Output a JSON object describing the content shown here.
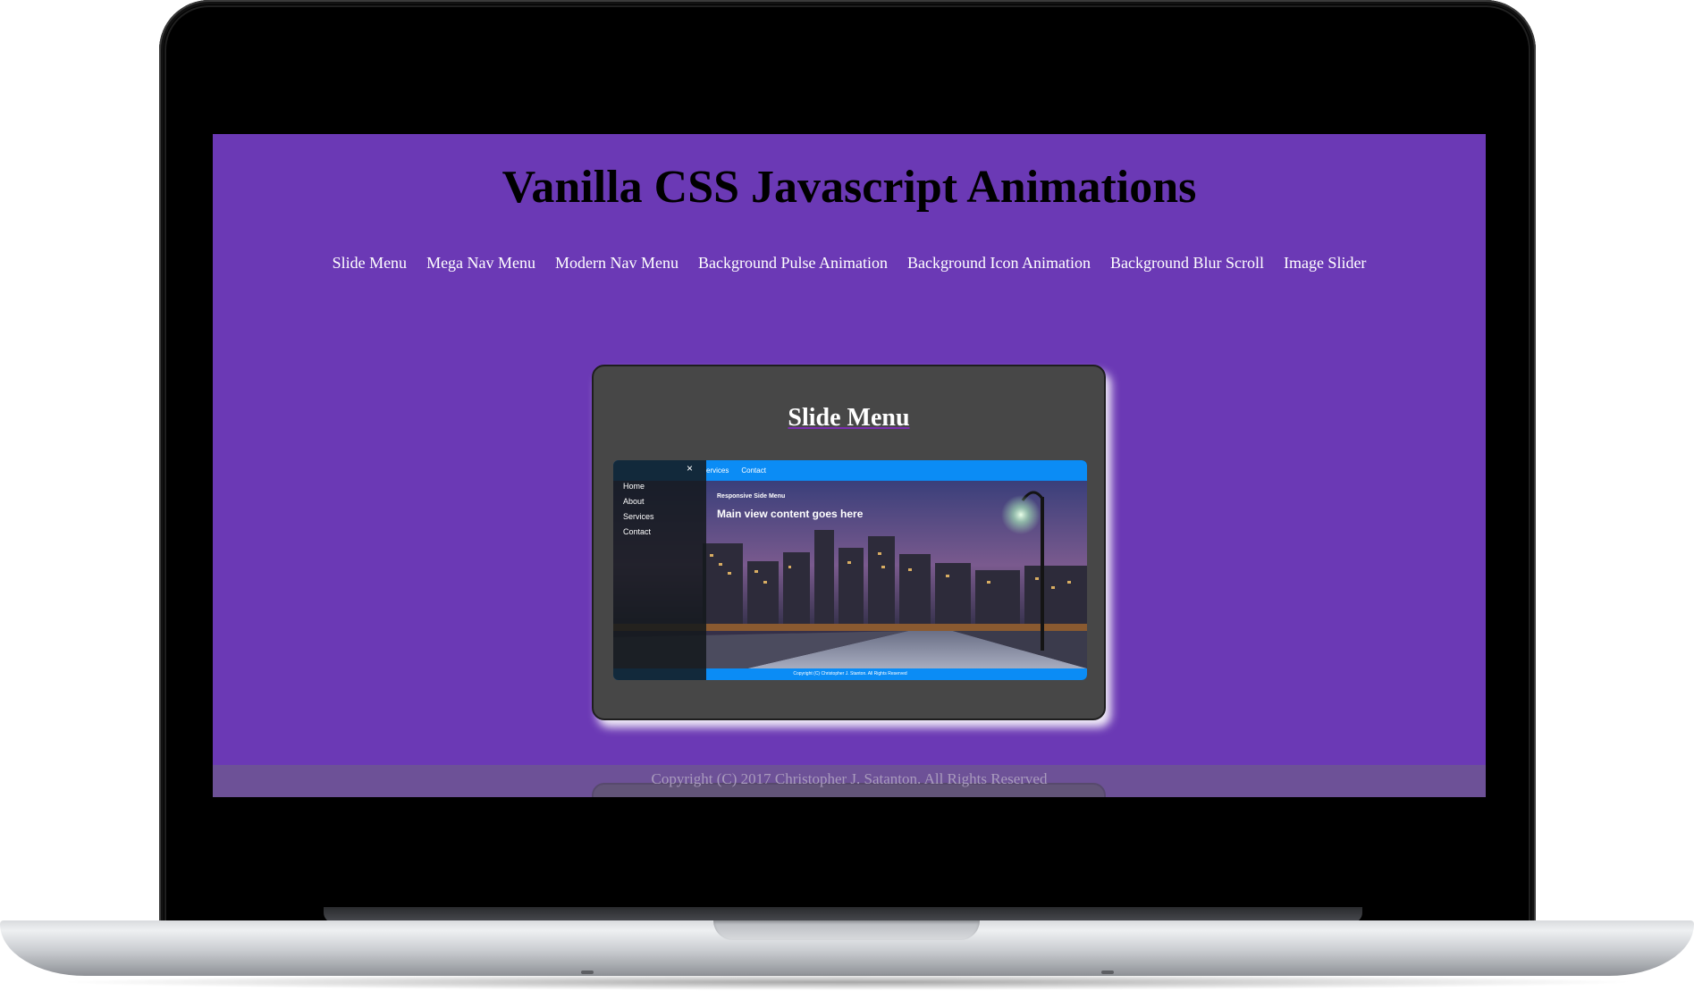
{
  "page": {
    "title": "Vanilla CSS Javascript Animations",
    "nav": [
      "Slide Menu",
      "Mega Nav Menu",
      "Modern Nav Menu",
      "Background Pulse Animation",
      "Background Icon Animation",
      "Background Blur Scroll",
      "Image Slider"
    ],
    "cards": [
      {
        "title": "Slide Menu",
        "preview": {
          "top_links": [
            "ervices",
            "Contact"
          ],
          "side_menu": [
            "Home",
            "About",
            "Services",
            "Contact"
          ],
          "close_icon": "×",
          "heading": "Responsive Side Menu",
          "main_text": "Main view content goes here",
          "footer": "Copyright (C) Christopher J. Stanton. All Rights Reserved"
        }
      }
    ],
    "footer": "Copyright (C) 2017 Christopher J. Satanton. All Rights Reserved"
  },
  "colors": {
    "background": "#6b39b5",
    "card": "#474747",
    "preview_bar": "#0b8cf5"
  }
}
